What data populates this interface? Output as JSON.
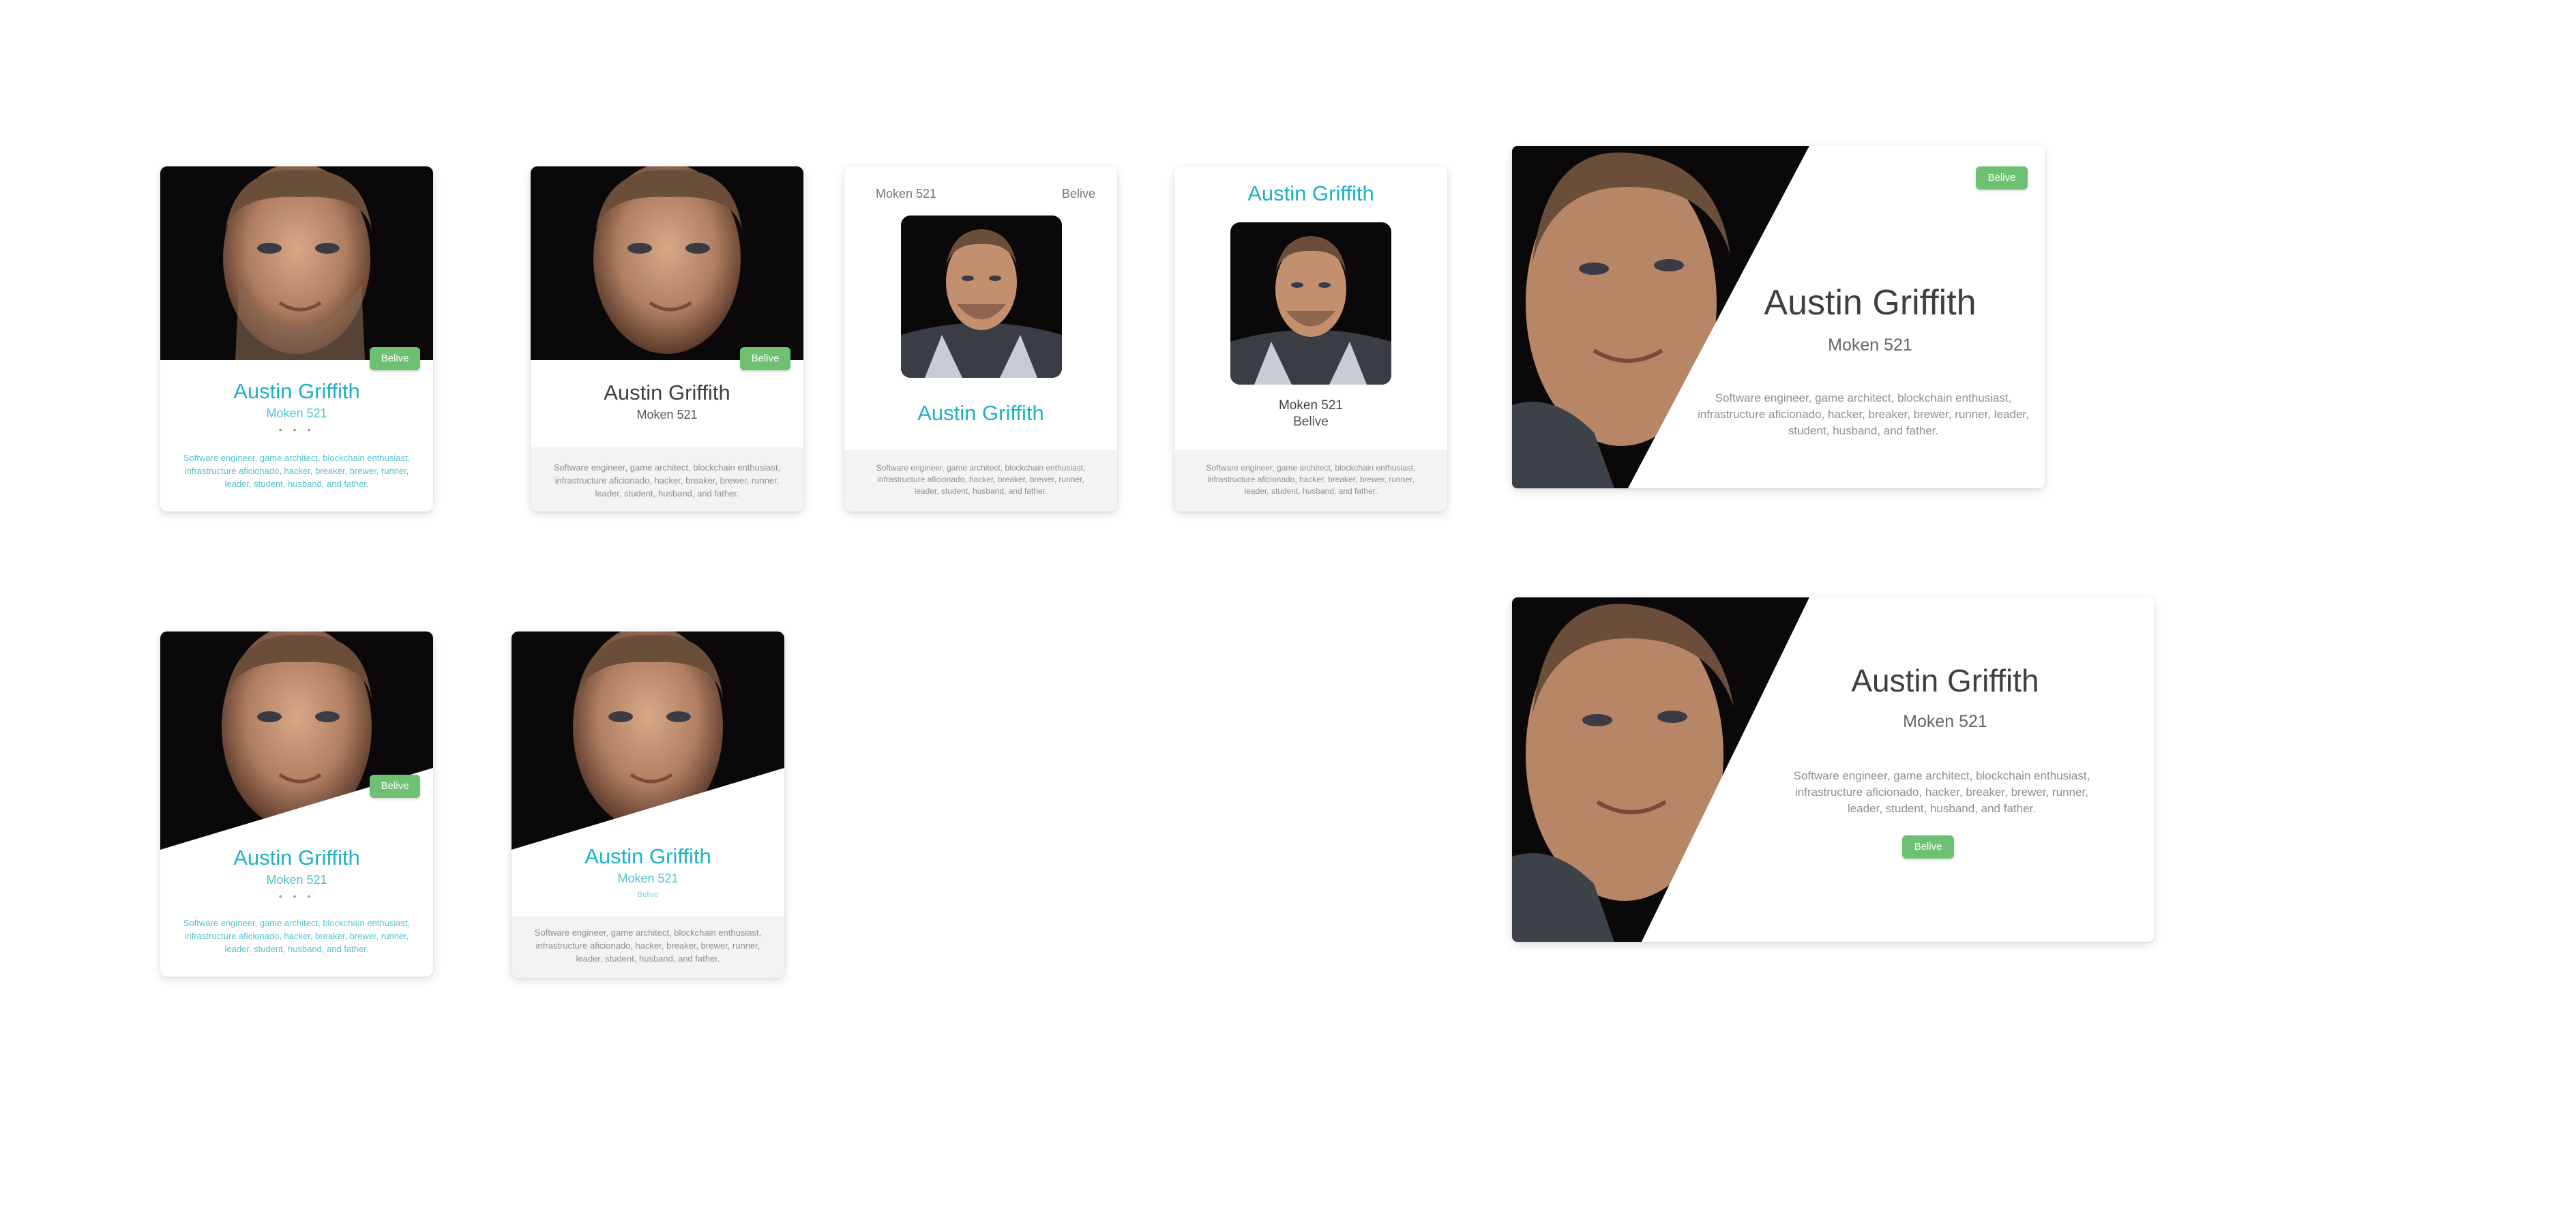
{
  "profile": {
    "name": "Austin Griffith",
    "handle": "Moken 521",
    "badge": "Belive",
    "dots": "• • •",
    "bio": "Software engineer, game architect, blockchain enthusiast, infrastructure aficionado, hacker, breaker, brewer, runner, leader, student, husband, and father."
  },
  "colors": {
    "accent_teal": "#1cb2c6",
    "badge_green": "#6ec173",
    "footer_gray": "#f3f3f5"
  }
}
